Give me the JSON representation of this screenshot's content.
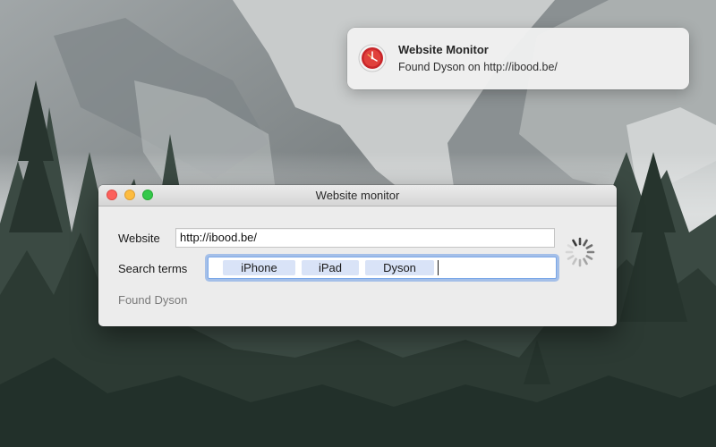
{
  "notification": {
    "app_icon": "clock-alarm-icon",
    "title": "Website Monitor",
    "body": "Found Dyson on http://ibood.be/"
  },
  "window": {
    "title": "Website monitor",
    "traffic_lights": {
      "close": "#fc605c",
      "minimize": "#fdbc40",
      "zoom": "#34c84a"
    },
    "website_label": "Website",
    "website_value": "http://ibood.be/",
    "search_terms_label": "Search terms",
    "search_terms": [
      "iPhone",
      "iPad",
      "Dyson"
    ],
    "status": "Found Dyson",
    "activity_indicator": "spinner-icon"
  },
  "colors": {
    "focus_ring": "#699be6",
    "token_background": "#d9e3f7"
  }
}
